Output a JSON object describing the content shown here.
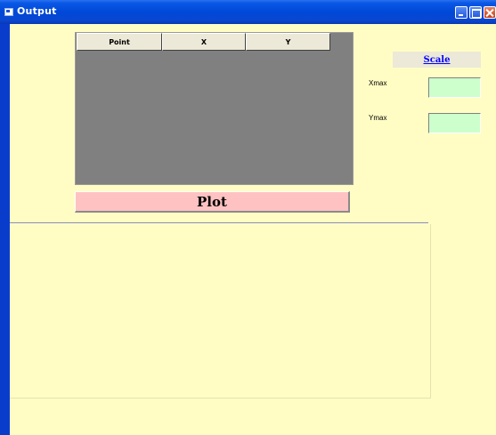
{
  "window": {
    "title": "Output",
    "controls": {
      "minimize_icon": "minimize-icon",
      "maximize_icon": "maximize-icon",
      "close_icon": "close-icon"
    },
    "colors": {
      "titlebar": "#0048d8",
      "client_background": "#fffdc4"
    }
  },
  "grid": {
    "columns": [
      "Point",
      "X",
      "Y"
    ],
    "rows": [],
    "background": "#808080"
  },
  "plot_button": {
    "label": "Plot",
    "color": "#ffc2c2"
  },
  "scale": {
    "heading": "Scale",
    "heading_color": "#0000ff",
    "xmax": {
      "label": "Xmax",
      "value": ""
    },
    "ymax": {
      "label": "Ymax",
      "value": ""
    },
    "field_color": "#ccffcc"
  }
}
